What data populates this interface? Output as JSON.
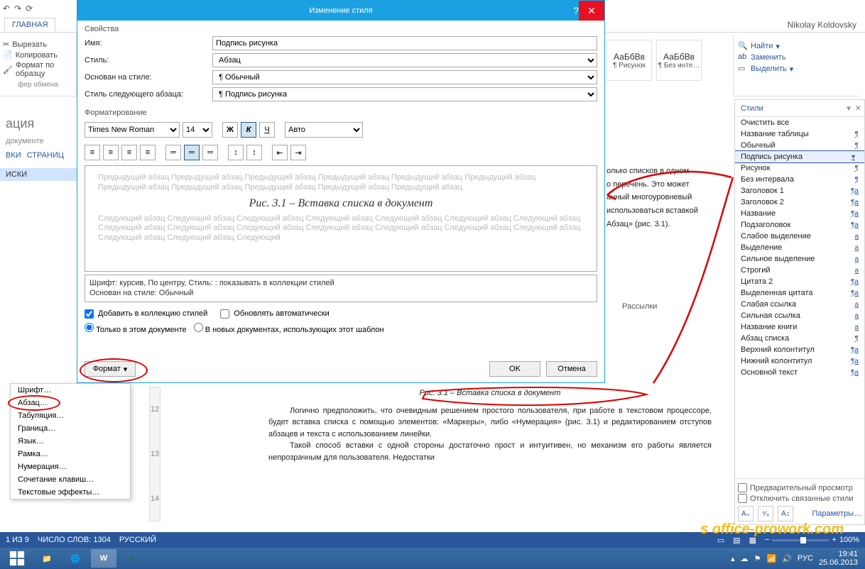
{
  "qat": {
    "items": [
      "⟳",
      "↶",
      "↷"
    ]
  },
  "ribbon": {
    "tabs": {
      "home": "ГЛАВНАЯ"
    },
    "account": "Nikolay Koldovsky",
    "clipboard": {
      "cut": "Вырезать",
      "copy": "Копировать",
      "fmt": "Формат по образцу",
      "group": "фер обмена"
    },
    "editing": {
      "find": "Найти",
      "replace": "Заменить",
      "select": "Выделить"
    },
    "style_gallery": [
      {
        "sample": "АаБбВв",
        "label": "¶ Рисунок"
      },
      {
        "sample": "АаБбВв",
        "label": "¶ Без инте…"
      }
    ]
  },
  "nav": {
    "title": "ация",
    "sub": "документе",
    "tab1": "ВКИ",
    "tab2": "СТРАНИЦ",
    "item": "ИСКИ"
  },
  "dialog": {
    "title": "Изменение стиля",
    "section_props": "Свойства",
    "name_label": "Имя:",
    "name_value": "Подпись рисунка",
    "style_label": "Стиль:",
    "style_value": "Абзац",
    "based_label": "Основан на стиле:",
    "based_value": "¶  Обычный",
    "next_label": "Стиль следующего абзаца:",
    "next_value": "¶  Подпись рисунка",
    "section_fmt": "Форматирование",
    "font": "Times New Roman",
    "size": "14",
    "color": "Авто",
    "bold": "Ж",
    "italic": "К",
    "underline": "Ч",
    "preview_prev": "Предыдущий абзац Предыдущий абзац Предыдущий абзац Предыдущий абзац Предыдущий абзац Предыдущий абзац Предыдущий абзац Предыдущий абзац Предыдущий абзац Предыдущий абзац Предыдущий абзац",
    "preview_caption": "Рис. 3.1 – Вставка списка в документ",
    "preview_next": "Следующий абзац Следующий абзац Следующий абзац Следующий абзац Следующий абзац Следующий абзац Следующий абзац Следующий абзац Следующий абзац Следующий абзац Следующий абзац Следующий абзац Следующий абзац Следующий абзац Следующий абзац Следующий абзац Следующий",
    "desc_line1": "Шрифт: курсив, По центру, Стиль: : показывать в коллекции стилей",
    "desc_line2": "Основан на стиле: Обычный",
    "add_collection": "Добавить в коллекцию стилей",
    "auto_update": "Обновлять автоматически",
    "only_doc": "Только в этом документе",
    "in_templates": "В новых документах, использующих этот шаблон",
    "format_btn": "Формат",
    "ok": "OK",
    "cancel": "Отмена"
  },
  "context": [
    "Шрифт…",
    "Абзац…",
    "Табуляция…",
    "Граница…",
    "Язык…",
    "Рамка…",
    "Нумерация…",
    "Сочетание клавиш…",
    "Текстовые эффекты…"
  ],
  "doc": {
    "caption": "Рис. 3.1 – Вставка списка в документ",
    "p1": "Логично предположить, что очевидным решением простого пользователя, при работе в текстовом процессоре, будет вставка списка с помощью элементов: «Маркеры», либо «Нумерация» (рис. 3.1) и редактированием отступов абзацев и текста с использованием линейки.",
    "p2": "Такой способ вставки с одной стороны достаточно прост и интуитивен, но механизм его работы является непрозрачным для пользователя. Недостатки",
    "bg1": "олько списков в одном",
    "bg2": "о перечень. Это может",
    "bg3": "анный многоуровневый",
    "bg4": "использоваться вставкой",
    "bg5": "Абзац» (рис. 3.1).",
    "bg6": "Рассылки"
  },
  "styles": {
    "title": "Стили",
    "clear": "Очистить все",
    "items": [
      {
        "n": "Название таблицы",
        "m": "¶"
      },
      {
        "n": "Обычный",
        "m": "¶"
      },
      {
        "n": "Подпись рисунка",
        "m": "▾",
        "sel": true
      },
      {
        "n": "Рисунок",
        "m": "¶"
      },
      {
        "n": "Без интервала",
        "m": "¶"
      },
      {
        "n": "Заголовок 1",
        "m": "¶a"
      },
      {
        "n": "Заголовок 2",
        "m": "¶a"
      },
      {
        "n": "Название",
        "m": "¶a"
      },
      {
        "n": "Подзаголовок",
        "m": "¶a"
      },
      {
        "n": "Слабое выделение",
        "m": "a"
      },
      {
        "n": "Выделение",
        "m": "a"
      },
      {
        "n": "Сильное выделение",
        "m": "a"
      },
      {
        "n": "Строгий",
        "m": "a"
      },
      {
        "n": "Цитата 2",
        "m": "¶a"
      },
      {
        "n": "Выделенная цитата",
        "m": "¶a"
      },
      {
        "n": "Слабая ссылка",
        "m": "a"
      },
      {
        "n": "Сильная ссылка",
        "m": "a"
      },
      {
        "n": "Название книги",
        "m": "a"
      },
      {
        "n": "Абзац списка",
        "m": "¶"
      },
      {
        "n": "Верхний колонтитул",
        "m": "¶a"
      },
      {
        "n": "Нижний колонтитул",
        "m": "¶a"
      },
      {
        "n": "Основной текст",
        "m": "¶a"
      }
    ],
    "chk_preview": "Предварительный просмотр",
    "chk_linked": "Отключить связанные стили",
    "params": "Параметры…"
  },
  "statusbar": {
    "page": "1 ИЗ 9",
    "words": "ЧИСЛО СЛОВ: 1304",
    "lang": "РУССКИЙ",
    "zoom": "100%"
  },
  "taskbar": {
    "lang": "РУС",
    "time": "19:41",
    "date": "25.06.2013"
  },
  "watermark": "s office-prowork.com"
}
